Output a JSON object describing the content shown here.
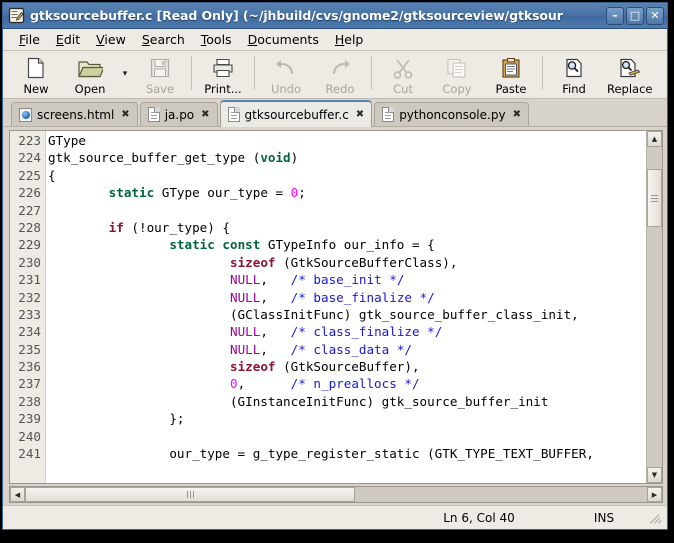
{
  "window": {
    "title": "gtksourcebuffer.c [Read Only] (~/jhbuild/cvs/gnome2/gtksourceview/gtksour",
    "icon": "editor-document-icon",
    "buttons": [
      {
        "name": "minimize",
        "glyph": "–"
      },
      {
        "name": "maximize",
        "glyph": "□"
      },
      {
        "name": "close",
        "glyph": "✕"
      }
    ]
  },
  "menubar": {
    "items": [
      {
        "mnemonic": "F",
        "rest": "ile"
      },
      {
        "mnemonic": "E",
        "rest": "dit"
      },
      {
        "mnemonic": "V",
        "rest": "iew"
      },
      {
        "mnemonic": "S",
        "rest": "earch"
      },
      {
        "mnemonic": "T",
        "rest": "ools"
      },
      {
        "mnemonic": "D",
        "rest": "ocuments"
      },
      {
        "mnemonic": "H",
        "rest": "elp"
      }
    ]
  },
  "toolbar": {
    "new_label": "New",
    "open_label": "Open",
    "open_dropdown": "▾",
    "save_label": "Save",
    "print_label": "Print...",
    "undo_label": "Undo",
    "redo_label": "Redo",
    "cut_label": "Cut",
    "copy_label": "Copy",
    "paste_label": "Paste",
    "find_label": "Find",
    "replace_label": "Replace"
  },
  "tabs": [
    {
      "label": "screens.html",
      "icon": "html-file-icon",
      "close": "✖",
      "active": false
    },
    {
      "label": "ja.po",
      "icon": "text-file-icon",
      "close": "✖",
      "active": false
    },
    {
      "label": "gtksourcebuffer.c",
      "icon": "text-file-icon",
      "close": "✖",
      "active": true
    },
    {
      "label": "pythonconsole.py",
      "icon": "text-file-icon",
      "close": "✖",
      "active": false
    }
  ],
  "editor": {
    "first_line": 223,
    "line_numbers": [
      223,
      224,
      225,
      226,
      227,
      228,
      229,
      230,
      231,
      232,
      233,
      234,
      235,
      236,
      237,
      238,
      239,
      240,
      241
    ],
    "lines": [
      [
        {
          "t": "GType",
          "c": ""
        }
      ],
      [
        {
          "t": "gtk_source_buffer_get_type (",
          "c": ""
        },
        {
          "t": "void",
          "c": "k"
        },
        {
          "t": ")",
          "c": ""
        }
      ],
      [
        {
          "t": "{",
          "c": ""
        }
      ],
      [
        {
          "t": "        ",
          "c": ""
        },
        {
          "t": "static",
          "c": "k"
        },
        {
          "t": " GType our_type = ",
          "c": ""
        },
        {
          "t": "0",
          "c": "m"
        },
        {
          "t": ";",
          "c": ""
        }
      ],
      [],
      [
        {
          "t": "        ",
          "c": ""
        },
        {
          "t": "if",
          "c": "kr"
        },
        {
          "t": " (!our_type) {",
          "c": ""
        }
      ],
      [
        {
          "t": "                ",
          "c": ""
        },
        {
          "t": "static const",
          "c": "k"
        },
        {
          "t": " GTypeInfo our_info = {",
          "c": ""
        }
      ],
      [
        {
          "t": "                        ",
          "c": ""
        },
        {
          "t": "sizeof",
          "c": "kr"
        },
        {
          "t": " (GtkSourceBufferClass),",
          "c": ""
        }
      ],
      [
        {
          "t": "                        ",
          "c": ""
        },
        {
          "t": "NULL",
          "c": "p"
        },
        {
          "t": ",   ",
          "c": ""
        },
        {
          "t": "/* base_init */",
          "c": "c"
        }
      ],
      [
        {
          "t": "                        ",
          "c": ""
        },
        {
          "t": "NULL",
          "c": "p"
        },
        {
          "t": ",   ",
          "c": ""
        },
        {
          "t": "/* base_finalize */",
          "c": "c"
        }
      ],
      [
        {
          "t": "                        (GClassInitFunc) gtk_source_buffer_class_init,",
          "c": ""
        }
      ],
      [
        {
          "t": "                        ",
          "c": ""
        },
        {
          "t": "NULL",
          "c": "p"
        },
        {
          "t": ",   ",
          "c": ""
        },
        {
          "t": "/* class_finalize */",
          "c": "c"
        }
      ],
      [
        {
          "t": "                        ",
          "c": ""
        },
        {
          "t": "NULL",
          "c": "p"
        },
        {
          "t": ",   ",
          "c": ""
        },
        {
          "t": "/* class_data */",
          "c": "c"
        }
      ],
      [
        {
          "t": "                        ",
          "c": ""
        },
        {
          "t": "sizeof",
          "c": "kr"
        },
        {
          "t": " (GtkSourceBuffer),",
          "c": ""
        }
      ],
      [
        {
          "t": "                        ",
          "c": ""
        },
        {
          "t": "0",
          "c": "m"
        },
        {
          "t": ",      ",
          "c": ""
        },
        {
          "t": "/* n_preallocs */",
          "c": "c"
        }
      ],
      [
        {
          "t": "                        (GInstanceInitFunc) gtk_source_buffer_init",
          "c": ""
        }
      ],
      [
        {
          "t": "                };",
          "c": ""
        }
      ],
      [],
      [
        {
          "t": "                our_type = g_type_register_static (GTK_TYPE_TEXT_BUFFER,",
          "c": ""
        }
      ]
    ],
    "colors": {
      "keyword_green": "#00663b",
      "keyword_red": "#8a1232",
      "null_purple": "#a000a0",
      "number_magenta": "#ff00ff",
      "comment_blue": "#1818d8",
      "background": "#ffffff",
      "gutter_background": "#eeebe5",
      "gutter_text": "#555555"
    }
  },
  "scrollbars": {
    "vertical_up": "▲",
    "vertical_down": "▼",
    "horizontal_left": "◀",
    "horizontal_right": "▶"
  },
  "statusbar": {
    "position": "Ln 6, Col 40",
    "insert_mode": "INS"
  }
}
